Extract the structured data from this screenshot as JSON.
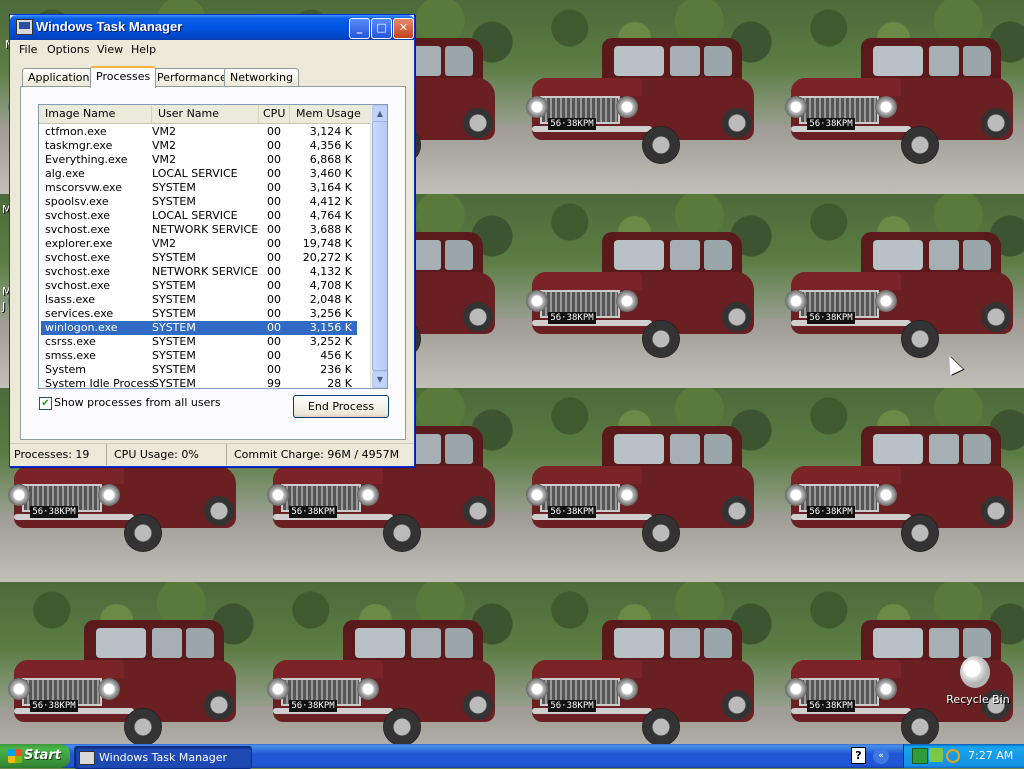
{
  "window": {
    "title": "Windows Task Manager",
    "menu": [
      "File",
      "Options",
      "View",
      "Help"
    ],
    "tabs": [
      "Applications",
      "Processes",
      "Performance",
      "Networking"
    ],
    "active_tab": "Processes",
    "columns": [
      "Image Name",
      "User Name",
      "CPU",
      "Mem Usage"
    ],
    "processes": [
      {
        "name": "ctfmon.exe",
        "user": "VM2",
        "cpu": "00",
        "mem": "3,124 K"
      },
      {
        "name": "taskmgr.exe",
        "user": "VM2",
        "cpu": "00",
        "mem": "4,356 K"
      },
      {
        "name": "Everything.exe",
        "user": "VM2",
        "cpu": "00",
        "mem": "6,868 K"
      },
      {
        "name": "alg.exe",
        "user": "LOCAL SERVICE",
        "cpu": "00",
        "mem": "3,460 K"
      },
      {
        "name": "mscorsvw.exe",
        "user": "SYSTEM",
        "cpu": "00",
        "mem": "3,164 K"
      },
      {
        "name": "spoolsv.exe",
        "user": "SYSTEM",
        "cpu": "00",
        "mem": "4,412 K"
      },
      {
        "name": "svchost.exe",
        "user": "LOCAL SERVICE",
        "cpu": "00",
        "mem": "4,764 K"
      },
      {
        "name": "svchost.exe",
        "user": "NETWORK SERVICE",
        "cpu": "00",
        "mem": "3,688 K"
      },
      {
        "name": "explorer.exe",
        "user": "VM2",
        "cpu": "00",
        "mem": "19,748 K"
      },
      {
        "name": "svchost.exe",
        "user": "SYSTEM",
        "cpu": "00",
        "mem": "20,272 K"
      },
      {
        "name": "svchost.exe",
        "user": "NETWORK SERVICE",
        "cpu": "00",
        "mem": "4,132 K"
      },
      {
        "name": "svchost.exe",
        "user": "SYSTEM",
        "cpu": "00",
        "mem": "4,708 K"
      },
      {
        "name": "lsass.exe",
        "user": "SYSTEM",
        "cpu": "00",
        "mem": "2,048 K"
      },
      {
        "name": "services.exe",
        "user": "SYSTEM",
        "cpu": "00",
        "mem": "3,256 K"
      },
      {
        "name": "winlogon.exe",
        "user": "SYSTEM",
        "cpu": "00",
        "mem": "3,156 K",
        "selected": true
      },
      {
        "name": "csrss.exe",
        "user": "SYSTEM",
        "cpu": "00",
        "mem": "3,252 K"
      },
      {
        "name": "smss.exe",
        "user": "SYSTEM",
        "cpu": "00",
        "mem": "456 K"
      },
      {
        "name": "System",
        "user": "SYSTEM",
        "cpu": "00",
        "mem": "236 K"
      },
      {
        "name": "System Idle Process",
        "user": "SYSTEM",
        "cpu": "99",
        "mem": "28 K"
      }
    ],
    "show_all_label": "Show processes from all users",
    "show_all_checked": true,
    "end_process_label": "End Process",
    "status": {
      "processes": "Processes: 19",
      "cpu": "CPU Usage: 0%",
      "commit": "Commit Charge: 96M / 4957M"
    },
    "minimize_glyph": "_",
    "maximize_glyph": "□",
    "close_glyph": "✕"
  },
  "desktop": {
    "plate_text": "56·38КРМ",
    "recycle_bin_label": "Recycle Bin",
    "left_edge_glyphs": [
      "M",
      "M",
      "M",
      "J"
    ]
  },
  "taskbar": {
    "start_label": "Start",
    "active_task": "Windows Task Manager",
    "help_glyph": "?",
    "tray_arrow_glyph": "«",
    "clock": "7:27 AM",
    "accent": "#2157d7",
    "start_green": "#48b548"
  }
}
